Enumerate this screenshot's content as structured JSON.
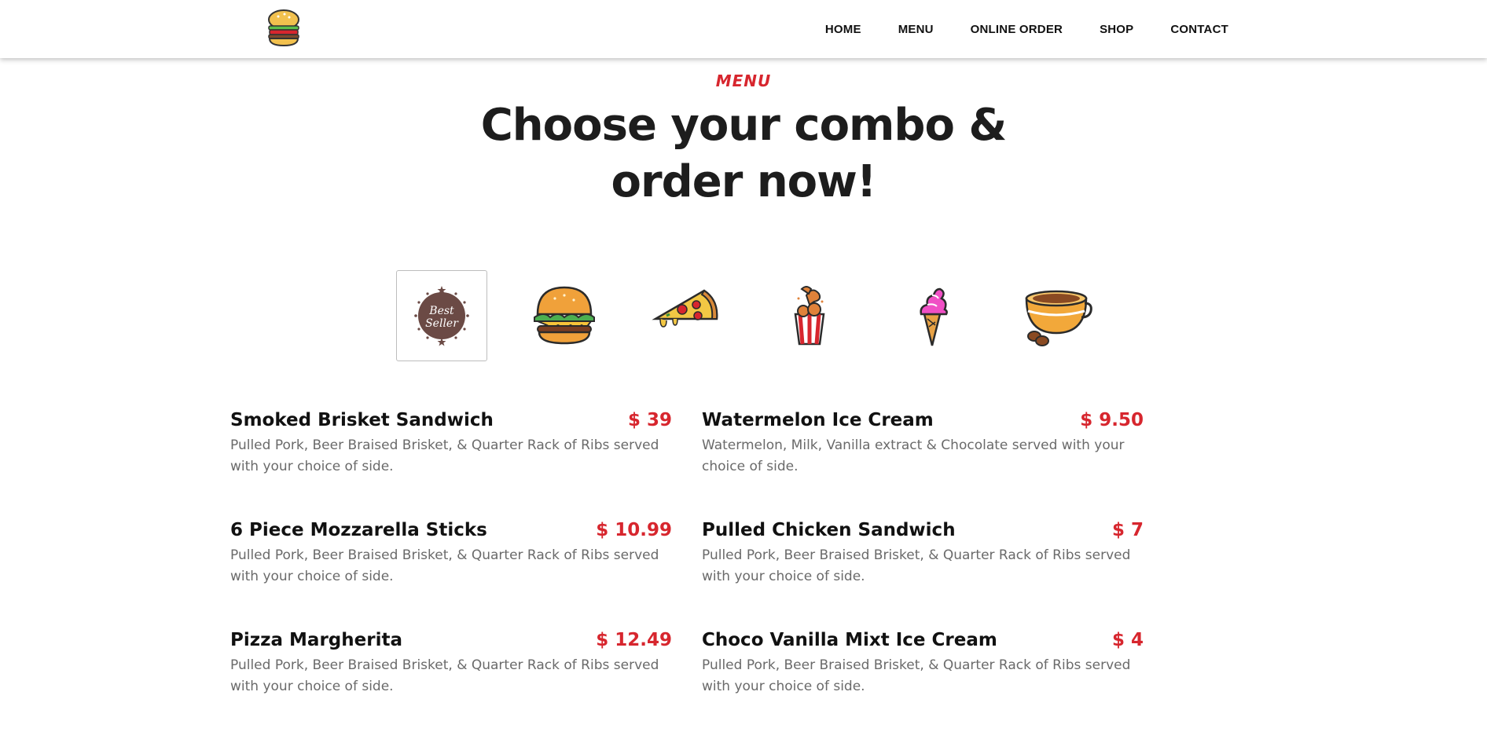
{
  "nav": {
    "items": [
      "HOME",
      "MENU",
      "ONLINE ORDER",
      "SHOP",
      "CONTACT"
    ]
  },
  "section": {
    "eyebrow": "MENU",
    "title_line1": "Choose your combo &",
    "title_line2": "order now!"
  },
  "categories": [
    {
      "icon": "best-seller-badge-icon",
      "label_top": "Best",
      "label_bottom": "Seller",
      "active": true
    },
    {
      "icon": "burger-icon",
      "active": false
    },
    {
      "icon": "pizza-slice-icon",
      "active": false
    },
    {
      "icon": "fried-chicken-bucket-icon",
      "active": false
    },
    {
      "icon": "ice-cream-cone-icon",
      "active": false
    },
    {
      "icon": "coffee-cup-icon",
      "active": false
    }
  ],
  "menu_items": [
    {
      "name": "Smoked Brisket Sandwich",
      "price": "$ 39",
      "desc": "Pulled Pork, Beer Braised Brisket, & Quarter Rack of Ribs served with your choice of side."
    },
    {
      "name": "Watermelon Ice Cream",
      "price": "$ 9.50",
      "desc": "Watermelon, Milk, Vanilla extract & Chocolate served with your choice of side."
    },
    {
      "name": "6 Piece Mozzarella Sticks",
      "price": "$ 10.99",
      "desc": "Pulled Pork, Beer Braised Brisket, & Quarter Rack of Ribs served with your choice of side."
    },
    {
      "name": "Pulled Chicken Sandwich",
      "price": "$ 7",
      "desc": "Pulled Pork, Beer Braised Brisket, & Quarter Rack of Ribs served with your choice of side."
    },
    {
      "name": "Pizza Margherita",
      "price": "$ 12.49",
      "desc": "Pulled Pork, Beer Braised Brisket, & Quarter Rack of Ribs served with your choice of side."
    },
    {
      "name": "Choco Vanilla Mixt Ice Cream",
      "price": "$ 4",
      "desc": "Pulled Pork, Beer Braised Brisket, & Quarter Rack of Ribs served with your choice of side."
    }
  ],
  "colors": {
    "accent": "#d7262e",
    "heading": "#1d1d1d",
    "body_text": "#6a6a6a",
    "badge": "#6b4a45"
  }
}
